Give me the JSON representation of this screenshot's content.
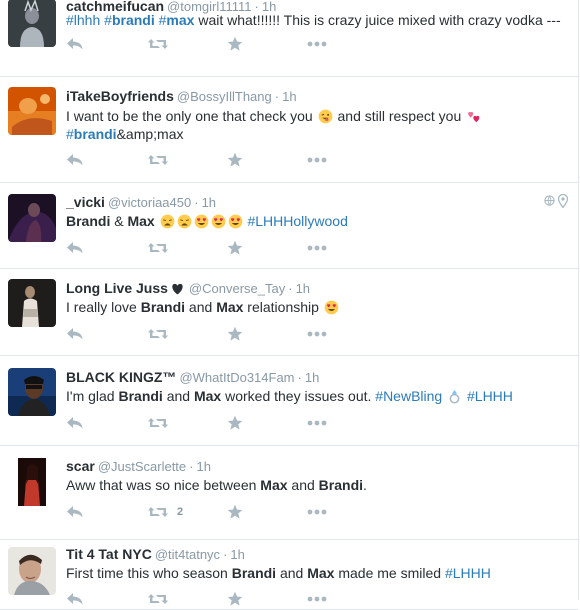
{
  "tweets": [
    {
      "name": "catchmeifucan",
      "handle": "@tomgirl11111",
      "time": "1h",
      "segments": [
        {
          "t": "tag",
          "v": "#lhhh"
        },
        {
          "t": "text",
          "v": " "
        },
        {
          "t": "tagb",
          "v": "#",
          "b": "brandi"
        },
        {
          "t": "text",
          "v": " "
        },
        {
          "t": "tagb",
          "v": "#",
          "b": "max"
        },
        {
          "t": "text",
          "v": " wait what!!!!!! This is crazy juice mixed with crazy vodka ---"
        }
      ],
      "retweet_count": "",
      "avatar_icon": "user-avatar-dark"
    },
    {
      "name": "iTakeBoyfriends",
      "handle": "@BossyIllThang",
      "time": "1h",
      "segments": [
        {
          "t": "text",
          "v": "I want to be the only one that check you "
        },
        {
          "t": "emoji",
          "v": "face-tongue-wink-emoji"
        },
        {
          "t": "text",
          "v": " and still respect you "
        },
        {
          "t": "emoji",
          "v": "two-hearts-emoji"
        }
      ],
      "segments2": [
        {
          "t": "tagb",
          "v": "#",
          "b": "brandi"
        },
        {
          "t": "text",
          "v": "&amp;max"
        }
      ],
      "retweet_count": "",
      "avatar_icon": "user-avatar-orange"
    },
    {
      "name": "_vicki",
      "handle": "@victoriaa450",
      "time": "1h",
      "segments": [
        {
          "t": "bold",
          "v": "Brandi"
        },
        {
          "t": "text",
          "v": " & "
        },
        {
          "t": "bold",
          "v": "Max"
        },
        {
          "t": "text",
          "v": " "
        },
        {
          "t": "emoji",
          "v": "weary-face-emoji"
        },
        {
          "t": "emoji",
          "v": "weary-face-emoji"
        },
        {
          "t": "emoji",
          "v": "heart-eyes-emoji"
        },
        {
          "t": "emoji",
          "v": "heart-eyes-emoji"
        },
        {
          "t": "emoji",
          "v": "heart-eyes-emoji"
        },
        {
          "t": "text",
          "v": " "
        },
        {
          "t": "tag",
          "v": "#LHHHollywood"
        }
      ],
      "retweet_count": "",
      "avatar_icon": "user-avatar-purple",
      "has_geo": true
    },
    {
      "name": "Long Live Juss",
      "name_emoji": "black-heart-emoji",
      "handle": "@Converse_Tay",
      "time": "1h",
      "segments": [
        {
          "t": "text",
          "v": "I really love "
        },
        {
          "t": "bold",
          "v": "Brandi"
        },
        {
          "t": "text",
          "v": " and "
        },
        {
          "t": "bold",
          "v": "Max"
        },
        {
          "t": "text",
          "v": " relationship "
        },
        {
          "t": "emoji",
          "v": "heart-eyes-emoji"
        }
      ],
      "retweet_count": "",
      "avatar_icon": "user-avatar-grey"
    },
    {
      "name": "BLACK KINGZ™",
      "handle": "@WhatItDo314Fam",
      "time": "1h",
      "segments": [
        {
          "t": "text",
          "v": "I'm glad "
        },
        {
          "t": "bold",
          "v": "Brandi"
        },
        {
          "t": "text",
          "v": " and "
        },
        {
          "t": "bold",
          "v": "Max"
        },
        {
          "t": "text",
          "v": " worked they issues out. "
        },
        {
          "t": "tag",
          "v": "#NewBling"
        },
        {
          "t": "text",
          "v": " "
        },
        {
          "t": "emoji",
          "v": "ring-emoji"
        },
        {
          "t": "text",
          "v": " "
        },
        {
          "t": "tag",
          "v": "#LHHH"
        }
      ],
      "retweet_count": "",
      "avatar_icon": "user-avatar-blue"
    },
    {
      "name": "scar",
      "handle": "@JustScarlette",
      "time": "1h",
      "segments": [
        {
          "t": "text",
          "v": "Aww that was so nice between "
        },
        {
          "t": "bold",
          "v": "Max"
        },
        {
          "t": "text",
          "v": " and "
        },
        {
          "t": "bold",
          "v": "Brandi"
        },
        {
          "t": "text",
          "v": "."
        }
      ],
      "retweet_count": "2",
      "avatar_icon": "user-avatar-red"
    },
    {
      "name": "Tit 4 Tat NYC",
      "handle": "@tit4tatnyc",
      "time": "1h",
      "segments": [
        {
          "t": "text",
          "v": "First time this who season "
        },
        {
          "t": "bold",
          "v": "Brandi"
        },
        {
          "t": "text",
          "v": " and "
        },
        {
          "t": "bold",
          "v": "Max"
        },
        {
          "t": "text",
          "v": " made me smiled "
        },
        {
          "t": "tag",
          "v": "#LHHH"
        }
      ],
      "retweet_count": "",
      "avatar_icon": "user-avatar-light"
    }
  ],
  "icons": {
    "reply": "reply-icon",
    "retweet": "retweet-icon",
    "favorite": "favorite-star-icon",
    "more": "more-dots-icon"
  },
  "colors": {
    "link": "#2b7bb9",
    "muted": "#8899a6",
    "action": "#aab8c2",
    "divider": "#e1e8ed"
  }
}
